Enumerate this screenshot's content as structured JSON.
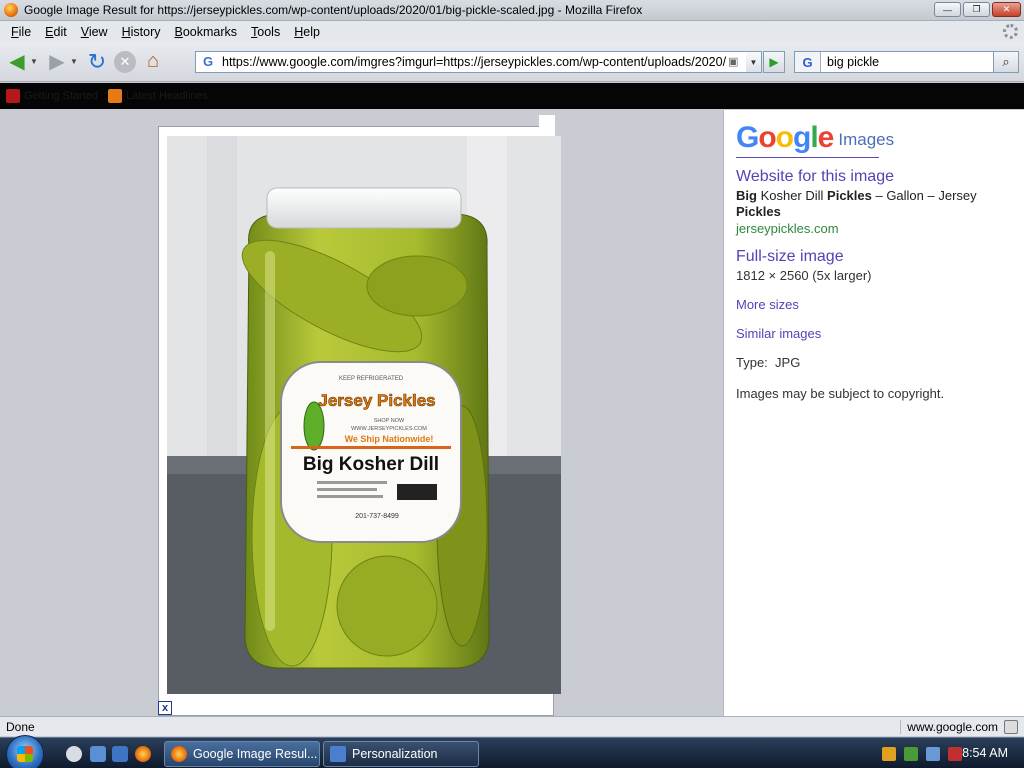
{
  "window": {
    "title": "Google Image Result for https://jerseypickles.com/wp-content/uploads/2020/01/big-pickle-scaled.jpg - Mozilla Firefox",
    "minimize": "—",
    "maximize": "❐",
    "close": "✕"
  },
  "menu": {
    "items": [
      "File",
      "Edit",
      "View",
      "History",
      "Bookmarks",
      "Tools",
      "Help"
    ],
    "accel": [
      "F",
      "E",
      "V",
      "H",
      "B",
      "T",
      "H"
    ]
  },
  "toolbar": {
    "url": "https://www.google.com/imgres?imgurl=https://jerseypickles.com/wp-content/uploads/2020/",
    "search_engine": "G",
    "search_value": "big pickle"
  },
  "bookmarks": {
    "items": [
      {
        "label": "Getting Started",
        "icon": "red-bookmark-icon"
      },
      {
        "label": "Latest Headlines",
        "icon": "rss-icon"
      }
    ]
  },
  "image": {
    "label_brand": "Jersey Pickles",
    "label_product": "Big Kosher Dill",
    "label_tagline": "We Ship Nationwide!",
    "label_top": "KEEP REFRIGERATED",
    "label_shop": "SHOP NOW",
    "label_site": "WWW.JERSEYPICKLES.COM",
    "label_phone": "201-737-8499",
    "close_x": "x"
  },
  "panel": {
    "logo_letters": [
      "G",
      "o",
      "o",
      "g",
      "l",
      "e"
    ],
    "logo_suffix": "Images",
    "website_link": "Website for this image",
    "title_parts": [
      "Big",
      " Kosher Dill ",
      "Pickles",
      " – Gallon – Jersey ",
      "Pickles"
    ],
    "domain": "jerseypickles.com",
    "fullsize_link": "Full-size image",
    "dimensions": "1812 × 2560 (5x larger)",
    "more_sizes": "More sizes",
    "similar": "Similar images",
    "type_label": "Type:",
    "type_value": "JPG",
    "copyright": "Images may be subject to copyright."
  },
  "status": {
    "text": "Done",
    "domain": "www.google.com"
  },
  "taskbar": {
    "tasks": [
      {
        "label": "Google Image Resul...",
        "active": true
      },
      {
        "label": "Personalization",
        "active": false
      }
    ],
    "clock": "8:54 AM"
  }
}
